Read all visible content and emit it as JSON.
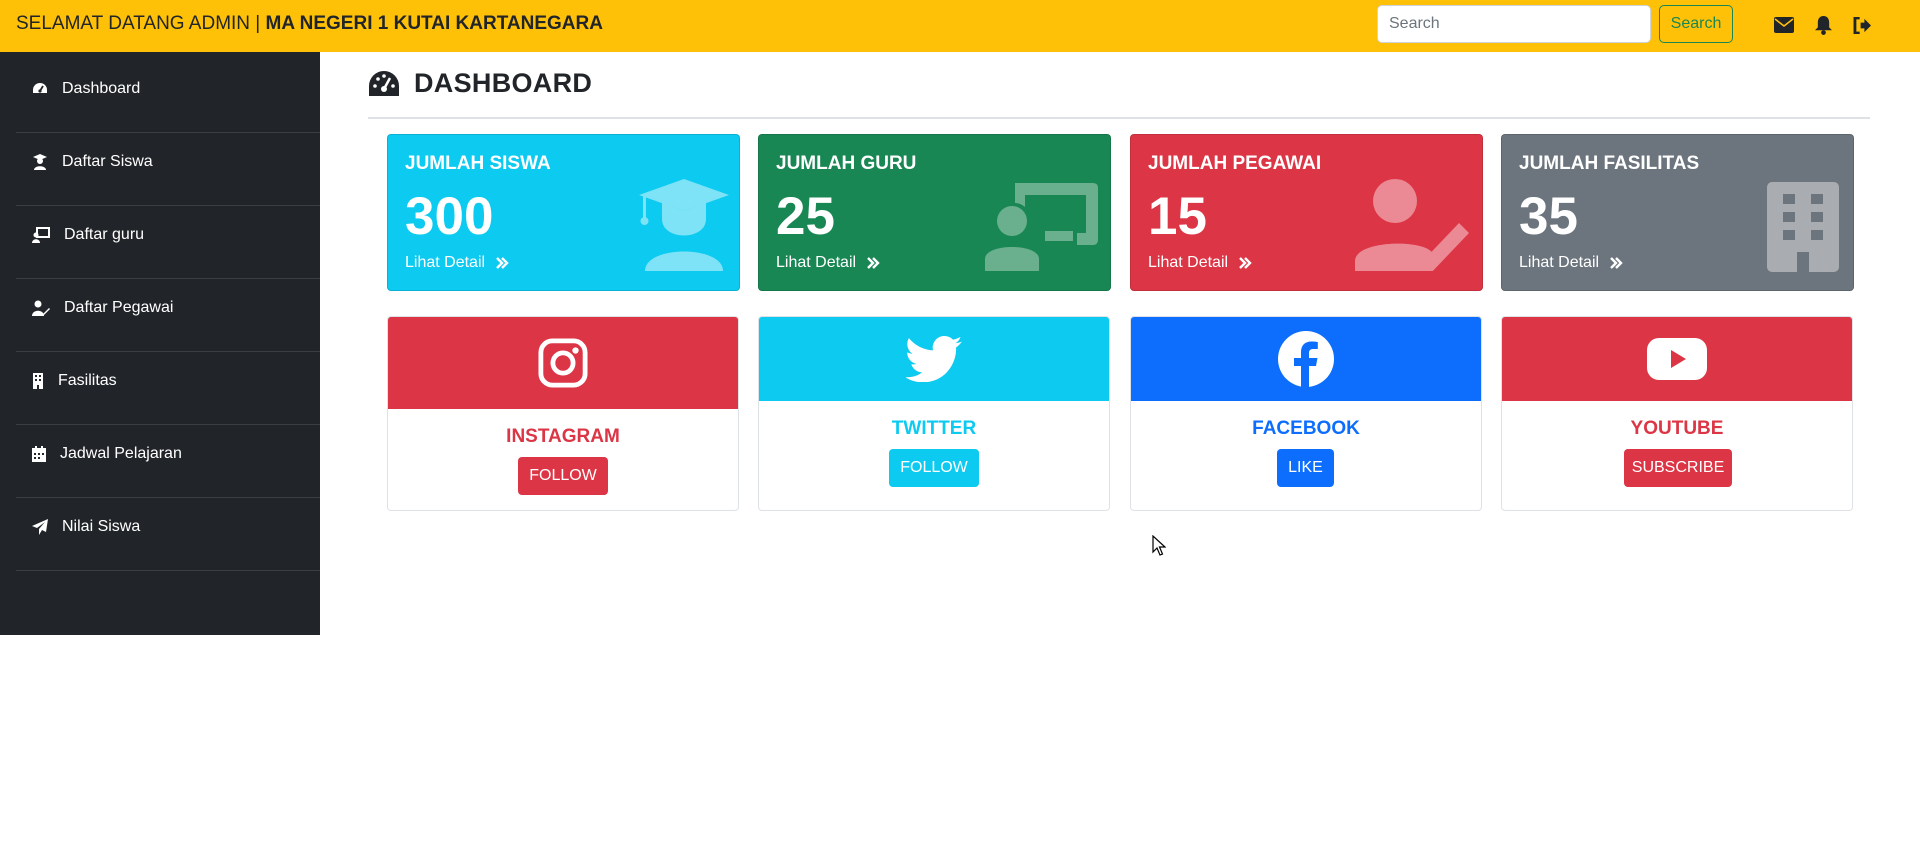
{
  "navbar": {
    "welcome": "SELAMAT DATANG ADMIN | ",
    "school": "MA NEGERI 1 KUTAI KARTANEGARA",
    "search_placeholder": "Search",
    "search_button": "Search",
    "icons": [
      "envelope-icon",
      "bell-icon",
      "sign-out-icon"
    ]
  },
  "sidebar": {
    "items": [
      {
        "label": "Dashboard",
        "icon": "tachometer-icon"
      },
      {
        "label": "Daftar Siswa",
        "icon": "student-icon"
      },
      {
        "label": "Daftar guru",
        "icon": "teacher-icon"
      },
      {
        "label": "Daftar Pegawai",
        "icon": "user-edit-icon"
      },
      {
        "label": "Fasilitas",
        "icon": "building-icon"
      },
      {
        "label": "Jadwal Pelajaran",
        "icon": "calendar-icon"
      },
      {
        "label": "Nilai Siswa",
        "icon": "paper-plane-icon"
      }
    ]
  },
  "main": {
    "title": "DASHBOARD",
    "stats": [
      {
        "label": "JUMLAH SISWA",
        "value": "300",
        "link": "Lihat Detail",
        "color": "#0dcaf0",
        "icon": "graduate-icon"
      },
      {
        "label": "JUMLAH GURU",
        "value": "25",
        "link": "Lihat Detail",
        "color": "#198754",
        "icon": "chalkboard-teacher-icon"
      },
      {
        "label": "JUMLAH PEGAWAI",
        "value": "15",
        "link": "Lihat Detail",
        "color": "#dc3545",
        "icon": "user-edit-icon"
      },
      {
        "label": "JUMLAH FASILITAS",
        "value": "35",
        "link": "Lihat Detail",
        "color": "#6c757d",
        "icon": "building-icon"
      }
    ],
    "social": [
      {
        "name": "INSTAGRAM",
        "button": "FOLLOW",
        "color": "#dc3545",
        "icon": "instagram-icon"
      },
      {
        "name": "TWITTER",
        "button": "FOLLOW",
        "color": "#0dcaf0",
        "icon": "twitter-icon"
      },
      {
        "name": "FACEBOOK",
        "button": "LIKE",
        "color": "#0d6efd",
        "icon": "facebook-icon"
      },
      {
        "name": "YOUTUBE",
        "button": "SUBSCRIBE",
        "color": "#dc3545",
        "icon": "youtube-icon"
      }
    ]
  }
}
